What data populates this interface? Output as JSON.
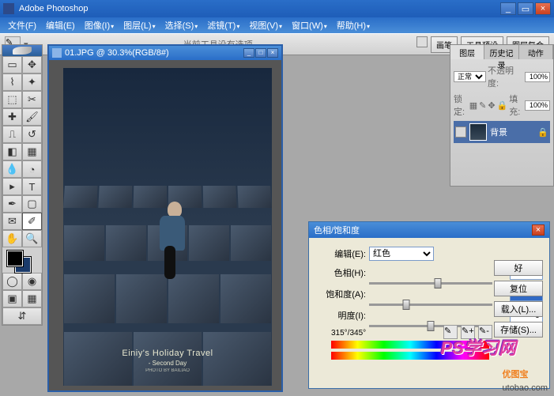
{
  "window": {
    "title": "Adobe Photoshop"
  },
  "menu": [
    "文件(F)",
    "编辑(E)",
    "图像(I)",
    "图层(L)",
    "选择(S)",
    "滤镜(T)",
    "视图(V)",
    "窗口(W)",
    "帮助(H)"
  ],
  "options": {
    "message": "当前工具没有选项。",
    "buttons": [
      "画笔",
      "工具预设",
      "图层复合"
    ]
  },
  "document": {
    "filename": "01.JPG",
    "zoom": "30.3%",
    "mode": "RGB/8#",
    "title_combined": "01.JPG @ 30.3%(RGB/8#)",
    "caption_main": "Einiy's Holiday Travel",
    "caption_sub": "- Second Day",
    "caption_by": "PHOTO BY BAILIAO"
  },
  "panels": {
    "tabs": [
      "图层",
      "历史记录",
      "动作"
    ],
    "blend_mode": "正常",
    "opacity_label": "不透明度:",
    "opacity_value": "100%",
    "lock_label": "锁定:",
    "fill_label": "填充:",
    "fill_value": "100%",
    "layer_name": "背景"
  },
  "dialog": {
    "title": "色相/饱和度",
    "edit_label": "编辑(E):",
    "edit_value": "红色",
    "hue_label": "色相(H):",
    "hue_value": "+12",
    "sat_label": "饱和度(A):",
    "sat_value": "-40",
    "light_label": "明度(I):",
    "light_value": "0",
    "degrees": "315°/345°",
    "buttons": {
      "ok": "好",
      "reset": "复位",
      "load": "载入(L)...",
      "save": "存储(S)..."
    }
  },
  "watermark1": "PS学习网",
  "watermark2_a": "优图宝",
  "watermark2_b": "utobao.com"
}
